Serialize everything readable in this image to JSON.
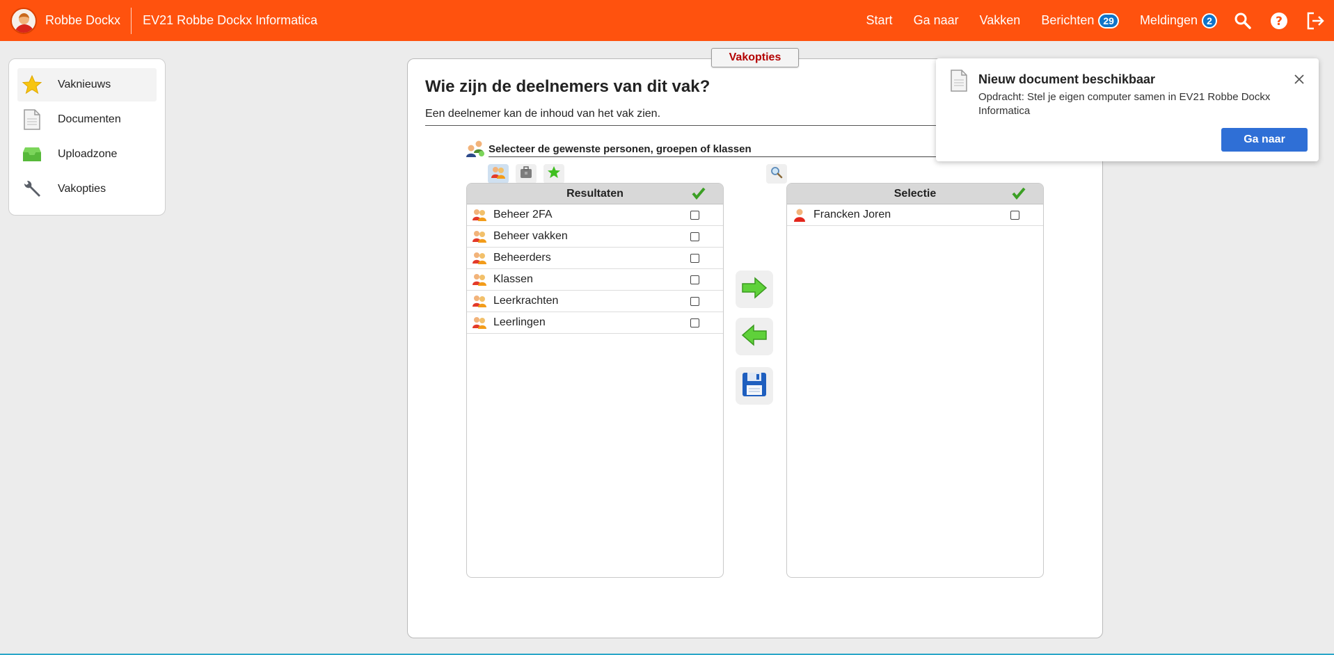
{
  "header": {
    "user_name": "Robbe Dockx",
    "course_title": "EV21 Robbe Dockx Informatica",
    "nav": [
      {
        "label": "Start"
      },
      {
        "label": "Ga naar"
      },
      {
        "label": "Vakken"
      },
      {
        "label": "Berichten",
        "badge": "29"
      },
      {
        "label": "Meldingen",
        "badge": "2"
      }
    ],
    "icons": [
      "search-icon",
      "help-icon",
      "logout-icon"
    ],
    "bar_color": "#ff520e"
  },
  "sidebar": {
    "items": [
      {
        "label": "Vaknieuws",
        "icon": "star-icon"
      },
      {
        "label": "Documenten",
        "icon": "document-icon"
      },
      {
        "label": "Uploadzone",
        "icon": "inbox-icon"
      },
      {
        "label": "Vakopties",
        "icon": "wrench-icon"
      }
    ]
  },
  "main": {
    "tab": "Vakopties",
    "title": "Wie zijn de deelnemers van dit vak?",
    "subtitle": "Een deelnemer kan de inhoud van het vak zien.",
    "select_label": "Selecteer de gewenste personen, groepen of klassen",
    "results": {
      "title": "Resultaten",
      "rows": [
        "Beheer 2FA",
        "Beheer vakken",
        "Beheerders",
        "Klassen",
        "Leerkrachten",
        "Leerlingen"
      ]
    },
    "selection": {
      "title": "Selectie",
      "rows": [
        "Francken Joren"
      ]
    }
  },
  "notification": {
    "title": "Nieuw document beschikbaar",
    "body": "Opdracht: Stel je eigen computer samen in EV21 Robbe Dockx Informatica",
    "button": "Ga naar"
  }
}
